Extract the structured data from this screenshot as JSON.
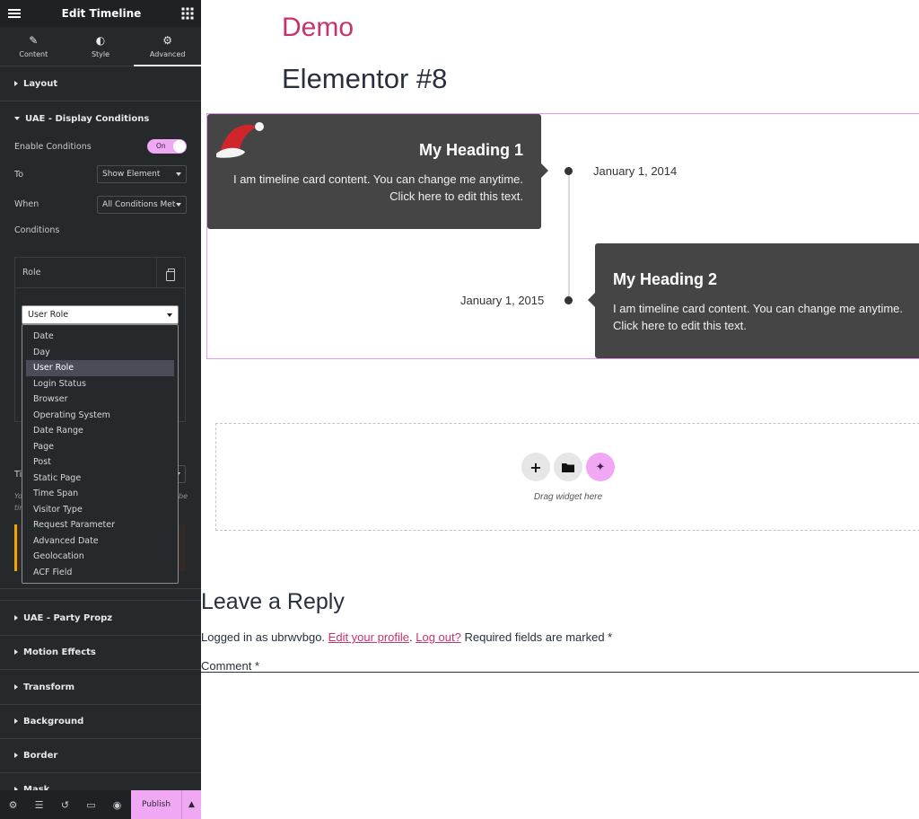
{
  "panel": {
    "title": "Edit Timeline",
    "tabs": [
      {
        "label": "Content",
        "icon": "pencil-icon"
      },
      {
        "label": "Style",
        "icon": "half-circle-icon"
      },
      {
        "label": "Advanced",
        "icon": "gear-icon",
        "active": true
      }
    ],
    "sections": {
      "layout": "Layout",
      "display_conditions": "UAE - Display Conditions",
      "party_propz": "UAE - Party Propz",
      "motion_effects": "Motion Effects",
      "transform": "Transform",
      "background": "Background",
      "border": "Border",
      "mask": "Mask"
    },
    "enable_conditions_label": "Enable Conditions",
    "toggle_state": "On",
    "to_label": "To",
    "to_value": "Show Element",
    "when_label": "When",
    "when_value": "All Conditions Met",
    "conditions_label": "Conditions",
    "repeater_item_label": "Role",
    "role_select_value": "User Role",
    "role_options": [
      "Date",
      "Day",
      "User Role",
      "Login Status",
      "Browser",
      "Operating System",
      "Date Range",
      "Page",
      "Post",
      "Static Page",
      "Time Span",
      "Visitor Type",
      "Request Parameter",
      "Advanced Date",
      "Geolocation",
      "ACF Field"
    ],
    "selected_option": "User Role",
    "behind_label_partial": "Ti",
    "behind_help_partial_1": "Yo",
    "behind_help_partial_2": "be",
    "behind_help_partial_3": "tir",
    "publish_label": "Publish",
    "accent_color": "#f0a8f5"
  },
  "preview": {
    "site_title": "Demo",
    "page_title": "Elementor #8",
    "timeline": [
      {
        "heading": "My Heading 1",
        "content": "I am timeline card content. You can change me anytime. Click here to edit this text.",
        "date": "January 1, 2014"
      },
      {
        "heading": "My Heading 2",
        "content": "I am timeline card content. You can change me anytime. Click here to edit this text.",
        "date": "January 1, 2015"
      }
    ],
    "drag_label": "Drag widget here",
    "reply_title": "Leave a Reply",
    "logged_prefix": "Logged in as ubrwvbgo.",
    "edit_profile": "Edit your profile",
    "log_out": "Log out?",
    "required_text": "Required fields are marked *",
    "comment_label": "Comment *",
    "brand_color": "#c7336d"
  }
}
